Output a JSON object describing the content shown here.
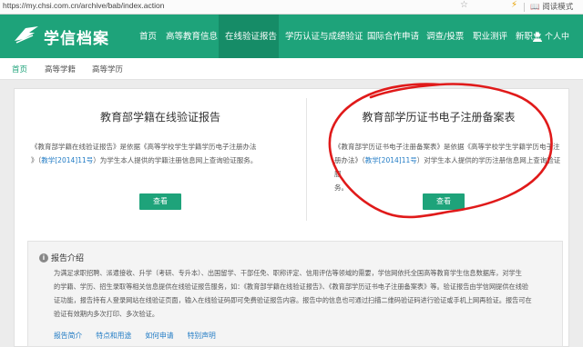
{
  "browser": {
    "url": "https://my.chsi.com.cn/archive/bab/index.action",
    "reading_mode": "阅读模式"
  },
  "header": {
    "logo_text": "学信档案",
    "nav": [
      "首页",
      "高等教育信息",
      "在线验证报告",
      "学历认证与成绩验证",
      "国际合作申请",
      "调查/投票",
      "职业测评",
      "新职业"
    ],
    "active_nav": "在线验证报告",
    "user": "个人中"
  },
  "subnav": {
    "items": [
      "首页",
      "高等学籍",
      "高等学历"
    ]
  },
  "left_panel": {
    "title": "教育部学籍在线验证报告",
    "desc_1": "《教育部学籍在线验证报告》是依据《高等学校学生学籍学历电子注册办法",
    "desc_2_pre": "》（",
    "desc_link": "教学[2014]11号",
    "desc_2_post": "）为学生本人提供的学籍注册信息网上查询验证服务。",
    "button": "查看"
  },
  "right_panel": {
    "title": "教育部学历证书电子注册备案表",
    "desc_1": "《教育部学历证书电子注册备案表》是依据《高等学校学生学籍学历电子注",
    "desc_2_pre": "册办法》（",
    "desc_link": "教学[2014]11号",
    "desc_2_post": "）对学生本人提供的学历注册信息网上查询验证服",
    "desc_3": "务。",
    "button": "查看"
  },
  "intro": {
    "title": "报告介绍",
    "line_1": "为满足求职招聘、派遣接收、升学（考研、专升本）、出国留学、干部任免、职称评定、信用评估等领域的需要，学信网依托全国高等教育学生信息数据库，对学生",
    "line_2": "的学籍、学历、招生录取等相关信息提供在线验证报告服务，如：《教育部学籍在线验证报告》、《教育部学历证书电子注册备案表》等。验证报告由学信网提供在线验",
    "line_3": "证功能，报告持有人登录网站在线验证页面，输入在线验证码即可免费验证报告内容。报告中的信息也可通过扫描二维码验证码进行验证或手机上网再验证。报告可在",
    "line_4": "验证有效期内多次打印、多次验证。",
    "links": [
      "报告简介",
      "特点和用途",
      "如何申请",
      "特别声明"
    ]
  },
  "colors": {
    "brand_green": "#1ea37a",
    "active_nav_green": "#168c67",
    "link_blue": "#1f7ac4",
    "annotation_red": "#e01a1a"
  }
}
